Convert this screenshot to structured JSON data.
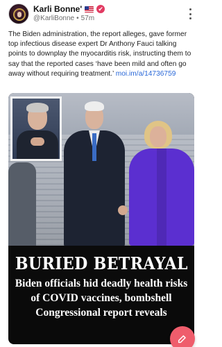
{
  "post": {
    "author": {
      "display_name": "Karli Bonne'",
      "handle": "@KarliBonne",
      "time_ago": "57m",
      "flag_icon": "us-flag-icon",
      "badge_icon": "verified-badge-icon"
    },
    "body_text": "The Biden administration, the report alleges, gave former top infectious disease expert Dr Anthony Fauci talking points to downplay the myocarditis risk, instructing them to say that the reported cases ‘have been mild and often go away without requiring treatment.’ ",
    "link_text": "moi.im/a/14736759",
    "media": {
      "headline": "BURIED BETRAYAL",
      "subheadline": "Biden officials hid deadly health risks of COVID vaccines, bombshell Congressional report reveals"
    }
  },
  "menu_icon": "more-vertical-icon",
  "compose_icon": "edit-icon",
  "colors": {
    "accent": "#ef5d6c",
    "link": "#2867d8",
    "verified": "#e23b62"
  }
}
